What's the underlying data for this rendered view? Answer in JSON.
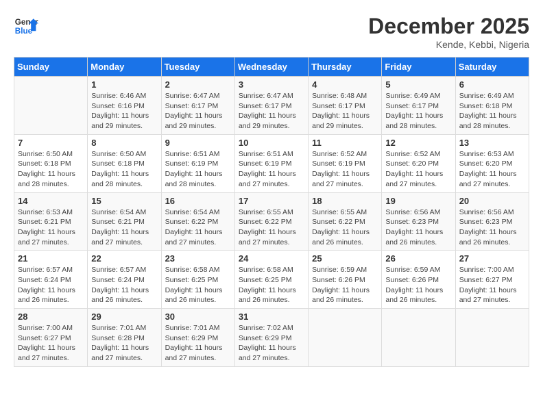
{
  "header": {
    "logo_line1": "General",
    "logo_line2": "Blue",
    "month_title": "December 2025",
    "location": "Kende, Kebbi, Nigeria"
  },
  "weekdays": [
    "Sunday",
    "Monday",
    "Tuesday",
    "Wednesday",
    "Thursday",
    "Friday",
    "Saturday"
  ],
  "weeks": [
    [
      {
        "day": "",
        "sunrise": "",
        "sunset": "",
        "daylight": ""
      },
      {
        "day": "1",
        "sunrise": "Sunrise: 6:46 AM",
        "sunset": "Sunset: 6:16 PM",
        "daylight": "Daylight: 11 hours and 29 minutes."
      },
      {
        "day": "2",
        "sunrise": "Sunrise: 6:47 AM",
        "sunset": "Sunset: 6:17 PM",
        "daylight": "Daylight: 11 hours and 29 minutes."
      },
      {
        "day": "3",
        "sunrise": "Sunrise: 6:47 AM",
        "sunset": "Sunset: 6:17 PM",
        "daylight": "Daylight: 11 hours and 29 minutes."
      },
      {
        "day": "4",
        "sunrise": "Sunrise: 6:48 AM",
        "sunset": "Sunset: 6:17 PM",
        "daylight": "Daylight: 11 hours and 29 minutes."
      },
      {
        "day": "5",
        "sunrise": "Sunrise: 6:49 AM",
        "sunset": "Sunset: 6:17 PM",
        "daylight": "Daylight: 11 hours and 28 minutes."
      },
      {
        "day": "6",
        "sunrise": "Sunrise: 6:49 AM",
        "sunset": "Sunset: 6:18 PM",
        "daylight": "Daylight: 11 hours and 28 minutes."
      }
    ],
    [
      {
        "day": "7",
        "sunrise": "Sunrise: 6:50 AM",
        "sunset": "Sunset: 6:18 PM",
        "daylight": "Daylight: 11 hours and 28 minutes."
      },
      {
        "day": "8",
        "sunrise": "Sunrise: 6:50 AM",
        "sunset": "Sunset: 6:18 PM",
        "daylight": "Daylight: 11 hours and 28 minutes."
      },
      {
        "day": "9",
        "sunrise": "Sunrise: 6:51 AM",
        "sunset": "Sunset: 6:19 PM",
        "daylight": "Daylight: 11 hours and 28 minutes."
      },
      {
        "day": "10",
        "sunrise": "Sunrise: 6:51 AM",
        "sunset": "Sunset: 6:19 PM",
        "daylight": "Daylight: 11 hours and 27 minutes."
      },
      {
        "day": "11",
        "sunrise": "Sunrise: 6:52 AM",
        "sunset": "Sunset: 6:19 PM",
        "daylight": "Daylight: 11 hours and 27 minutes."
      },
      {
        "day": "12",
        "sunrise": "Sunrise: 6:52 AM",
        "sunset": "Sunset: 6:20 PM",
        "daylight": "Daylight: 11 hours and 27 minutes."
      },
      {
        "day": "13",
        "sunrise": "Sunrise: 6:53 AM",
        "sunset": "Sunset: 6:20 PM",
        "daylight": "Daylight: 11 hours and 27 minutes."
      }
    ],
    [
      {
        "day": "14",
        "sunrise": "Sunrise: 6:53 AM",
        "sunset": "Sunset: 6:21 PM",
        "daylight": "Daylight: 11 hours and 27 minutes."
      },
      {
        "day": "15",
        "sunrise": "Sunrise: 6:54 AM",
        "sunset": "Sunset: 6:21 PM",
        "daylight": "Daylight: 11 hours and 27 minutes."
      },
      {
        "day": "16",
        "sunrise": "Sunrise: 6:54 AM",
        "sunset": "Sunset: 6:22 PM",
        "daylight": "Daylight: 11 hours and 27 minutes."
      },
      {
        "day": "17",
        "sunrise": "Sunrise: 6:55 AM",
        "sunset": "Sunset: 6:22 PM",
        "daylight": "Daylight: 11 hours and 27 minutes."
      },
      {
        "day": "18",
        "sunrise": "Sunrise: 6:55 AM",
        "sunset": "Sunset: 6:22 PM",
        "daylight": "Daylight: 11 hours and 26 minutes."
      },
      {
        "day": "19",
        "sunrise": "Sunrise: 6:56 AM",
        "sunset": "Sunset: 6:23 PM",
        "daylight": "Daylight: 11 hours and 26 minutes."
      },
      {
        "day": "20",
        "sunrise": "Sunrise: 6:56 AM",
        "sunset": "Sunset: 6:23 PM",
        "daylight": "Daylight: 11 hours and 26 minutes."
      }
    ],
    [
      {
        "day": "21",
        "sunrise": "Sunrise: 6:57 AM",
        "sunset": "Sunset: 6:24 PM",
        "daylight": "Daylight: 11 hours and 26 minutes."
      },
      {
        "day": "22",
        "sunrise": "Sunrise: 6:57 AM",
        "sunset": "Sunset: 6:24 PM",
        "daylight": "Daylight: 11 hours and 26 minutes."
      },
      {
        "day": "23",
        "sunrise": "Sunrise: 6:58 AM",
        "sunset": "Sunset: 6:25 PM",
        "daylight": "Daylight: 11 hours and 26 minutes."
      },
      {
        "day": "24",
        "sunrise": "Sunrise: 6:58 AM",
        "sunset": "Sunset: 6:25 PM",
        "daylight": "Daylight: 11 hours and 26 minutes."
      },
      {
        "day": "25",
        "sunrise": "Sunrise: 6:59 AM",
        "sunset": "Sunset: 6:26 PM",
        "daylight": "Daylight: 11 hours and 26 minutes."
      },
      {
        "day": "26",
        "sunrise": "Sunrise: 6:59 AM",
        "sunset": "Sunset: 6:26 PM",
        "daylight": "Daylight: 11 hours and 26 minutes."
      },
      {
        "day": "27",
        "sunrise": "Sunrise: 7:00 AM",
        "sunset": "Sunset: 6:27 PM",
        "daylight": "Daylight: 11 hours and 27 minutes."
      }
    ],
    [
      {
        "day": "28",
        "sunrise": "Sunrise: 7:00 AM",
        "sunset": "Sunset: 6:27 PM",
        "daylight": "Daylight: 11 hours and 27 minutes."
      },
      {
        "day": "29",
        "sunrise": "Sunrise: 7:01 AM",
        "sunset": "Sunset: 6:28 PM",
        "daylight": "Daylight: 11 hours and 27 minutes."
      },
      {
        "day": "30",
        "sunrise": "Sunrise: 7:01 AM",
        "sunset": "Sunset: 6:29 PM",
        "daylight": "Daylight: 11 hours and 27 minutes."
      },
      {
        "day": "31",
        "sunrise": "Sunrise: 7:02 AM",
        "sunset": "Sunset: 6:29 PM",
        "daylight": "Daylight: 11 hours and 27 minutes."
      },
      {
        "day": "",
        "sunrise": "",
        "sunset": "",
        "daylight": ""
      },
      {
        "day": "",
        "sunrise": "",
        "sunset": "",
        "daylight": ""
      },
      {
        "day": "",
        "sunrise": "",
        "sunset": "",
        "daylight": ""
      }
    ]
  ]
}
